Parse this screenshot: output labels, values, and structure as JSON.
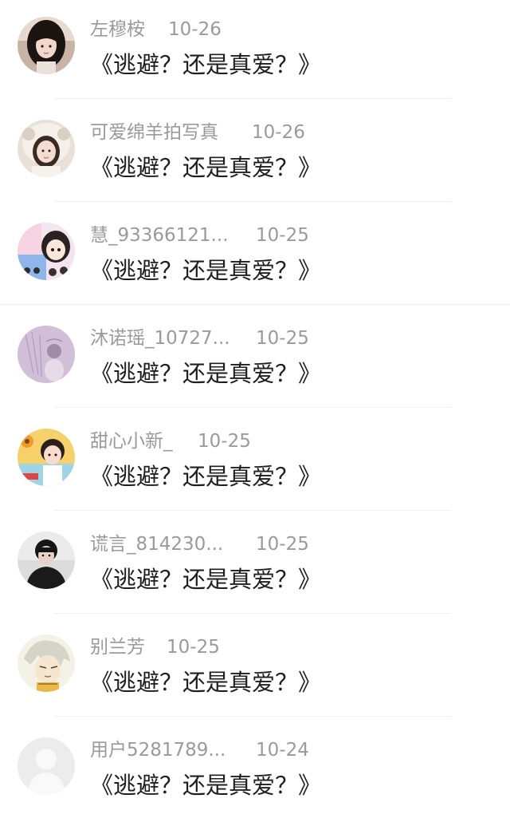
{
  "comments": [
    {
      "name": "左穆桉",
      "date": "10-26",
      "text": "《逃避？还是真爱？》",
      "avatar_icon": "girl-long-hair-avatar"
    },
    {
      "name": "可爱绵羊拍写真",
      "date": "10-26",
      "text": "《逃避？还是真爱？》",
      "avatar_icon": "girl-furry-hood-avatar"
    },
    {
      "name": "慧_93366121...",
      "date": "10-25",
      "text": "《逃避？还是真爱？》",
      "avatar_icon": "cartoon-collage-avatar"
    },
    {
      "name": "沐诺瑶_10727...",
      "date": "10-25",
      "text": "《逃避？还是真爱？》",
      "avatar_icon": "purple-sketch-avatar"
    },
    {
      "name": "甜心小新_",
      "date": "10-25",
      "text": "《逃避？还是真爱？》",
      "avatar_icon": "boy-sunflower-avatar"
    },
    {
      "name": "谎言_814230...",
      "date": "10-25",
      "text": "《逃避？还是真爱？》",
      "avatar_icon": "dark-portrait-avatar"
    },
    {
      "name": "别兰芳",
      "date": "10-25",
      "text": "《逃避？还是真爱？》",
      "avatar_icon": "anime-character-avatar"
    },
    {
      "name": "用户5281789...",
      "date": "10-24",
      "text": "《逃避？还是真爱？》",
      "avatar_icon": "default-user-avatar"
    }
  ]
}
